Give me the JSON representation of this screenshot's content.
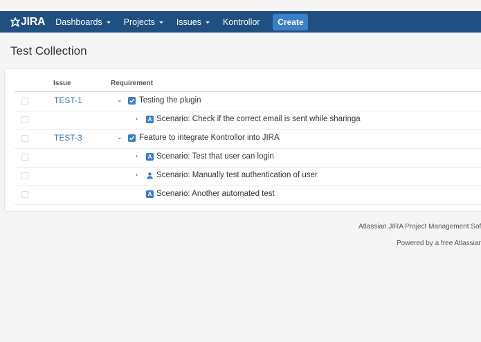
{
  "header": {
    "logo_text": "JIRA",
    "nav": [
      {
        "label": "Dashboards",
        "has_caret": true
      },
      {
        "label": "Projects",
        "has_caret": true
      },
      {
        "label": "Issues",
        "has_caret": true
      },
      {
        "label": "Kontrollor",
        "has_caret": false
      }
    ],
    "create_label": "Create"
  },
  "page": {
    "title": "Test Collection"
  },
  "table": {
    "columns": {
      "issue": "Issue",
      "requirement": "Requirement"
    },
    "rows": [
      {
        "issue": "TEST-1",
        "toggle": "expanded",
        "icon": "checkbox-icon",
        "text": "Testing the plugin"
      },
      {
        "issue": "",
        "toggle": "collapsed",
        "icon": "automated-icon",
        "text": "Scenario: Check if the correct email is sent while sharinga"
      },
      {
        "issue": "TEST-3",
        "toggle": "expanded",
        "icon": "checkbox-icon",
        "text": "Feature to integrate Kontrollor into JIRA"
      },
      {
        "issue": "",
        "toggle": "collapsed",
        "icon": "automated-icon",
        "text": "Scenario: Test that user can login"
      },
      {
        "issue": "",
        "toggle": "collapsed",
        "icon": "manual-user-icon",
        "text": "Scenario: Manually test authentication of user"
      },
      {
        "issue": "",
        "toggle": "none",
        "icon": "automated-icon",
        "text": "Scenario: Another automated test"
      }
    ]
  },
  "footer": {
    "line1": "Atlassian JIRA Project Management Softw",
    "line2": "Powered by a free Atlassian"
  },
  "colors": {
    "topbar": "#205081",
    "create_button": "#3b7fc4",
    "link": "#3572b0",
    "icon_blue": "#3b7fc4"
  }
}
